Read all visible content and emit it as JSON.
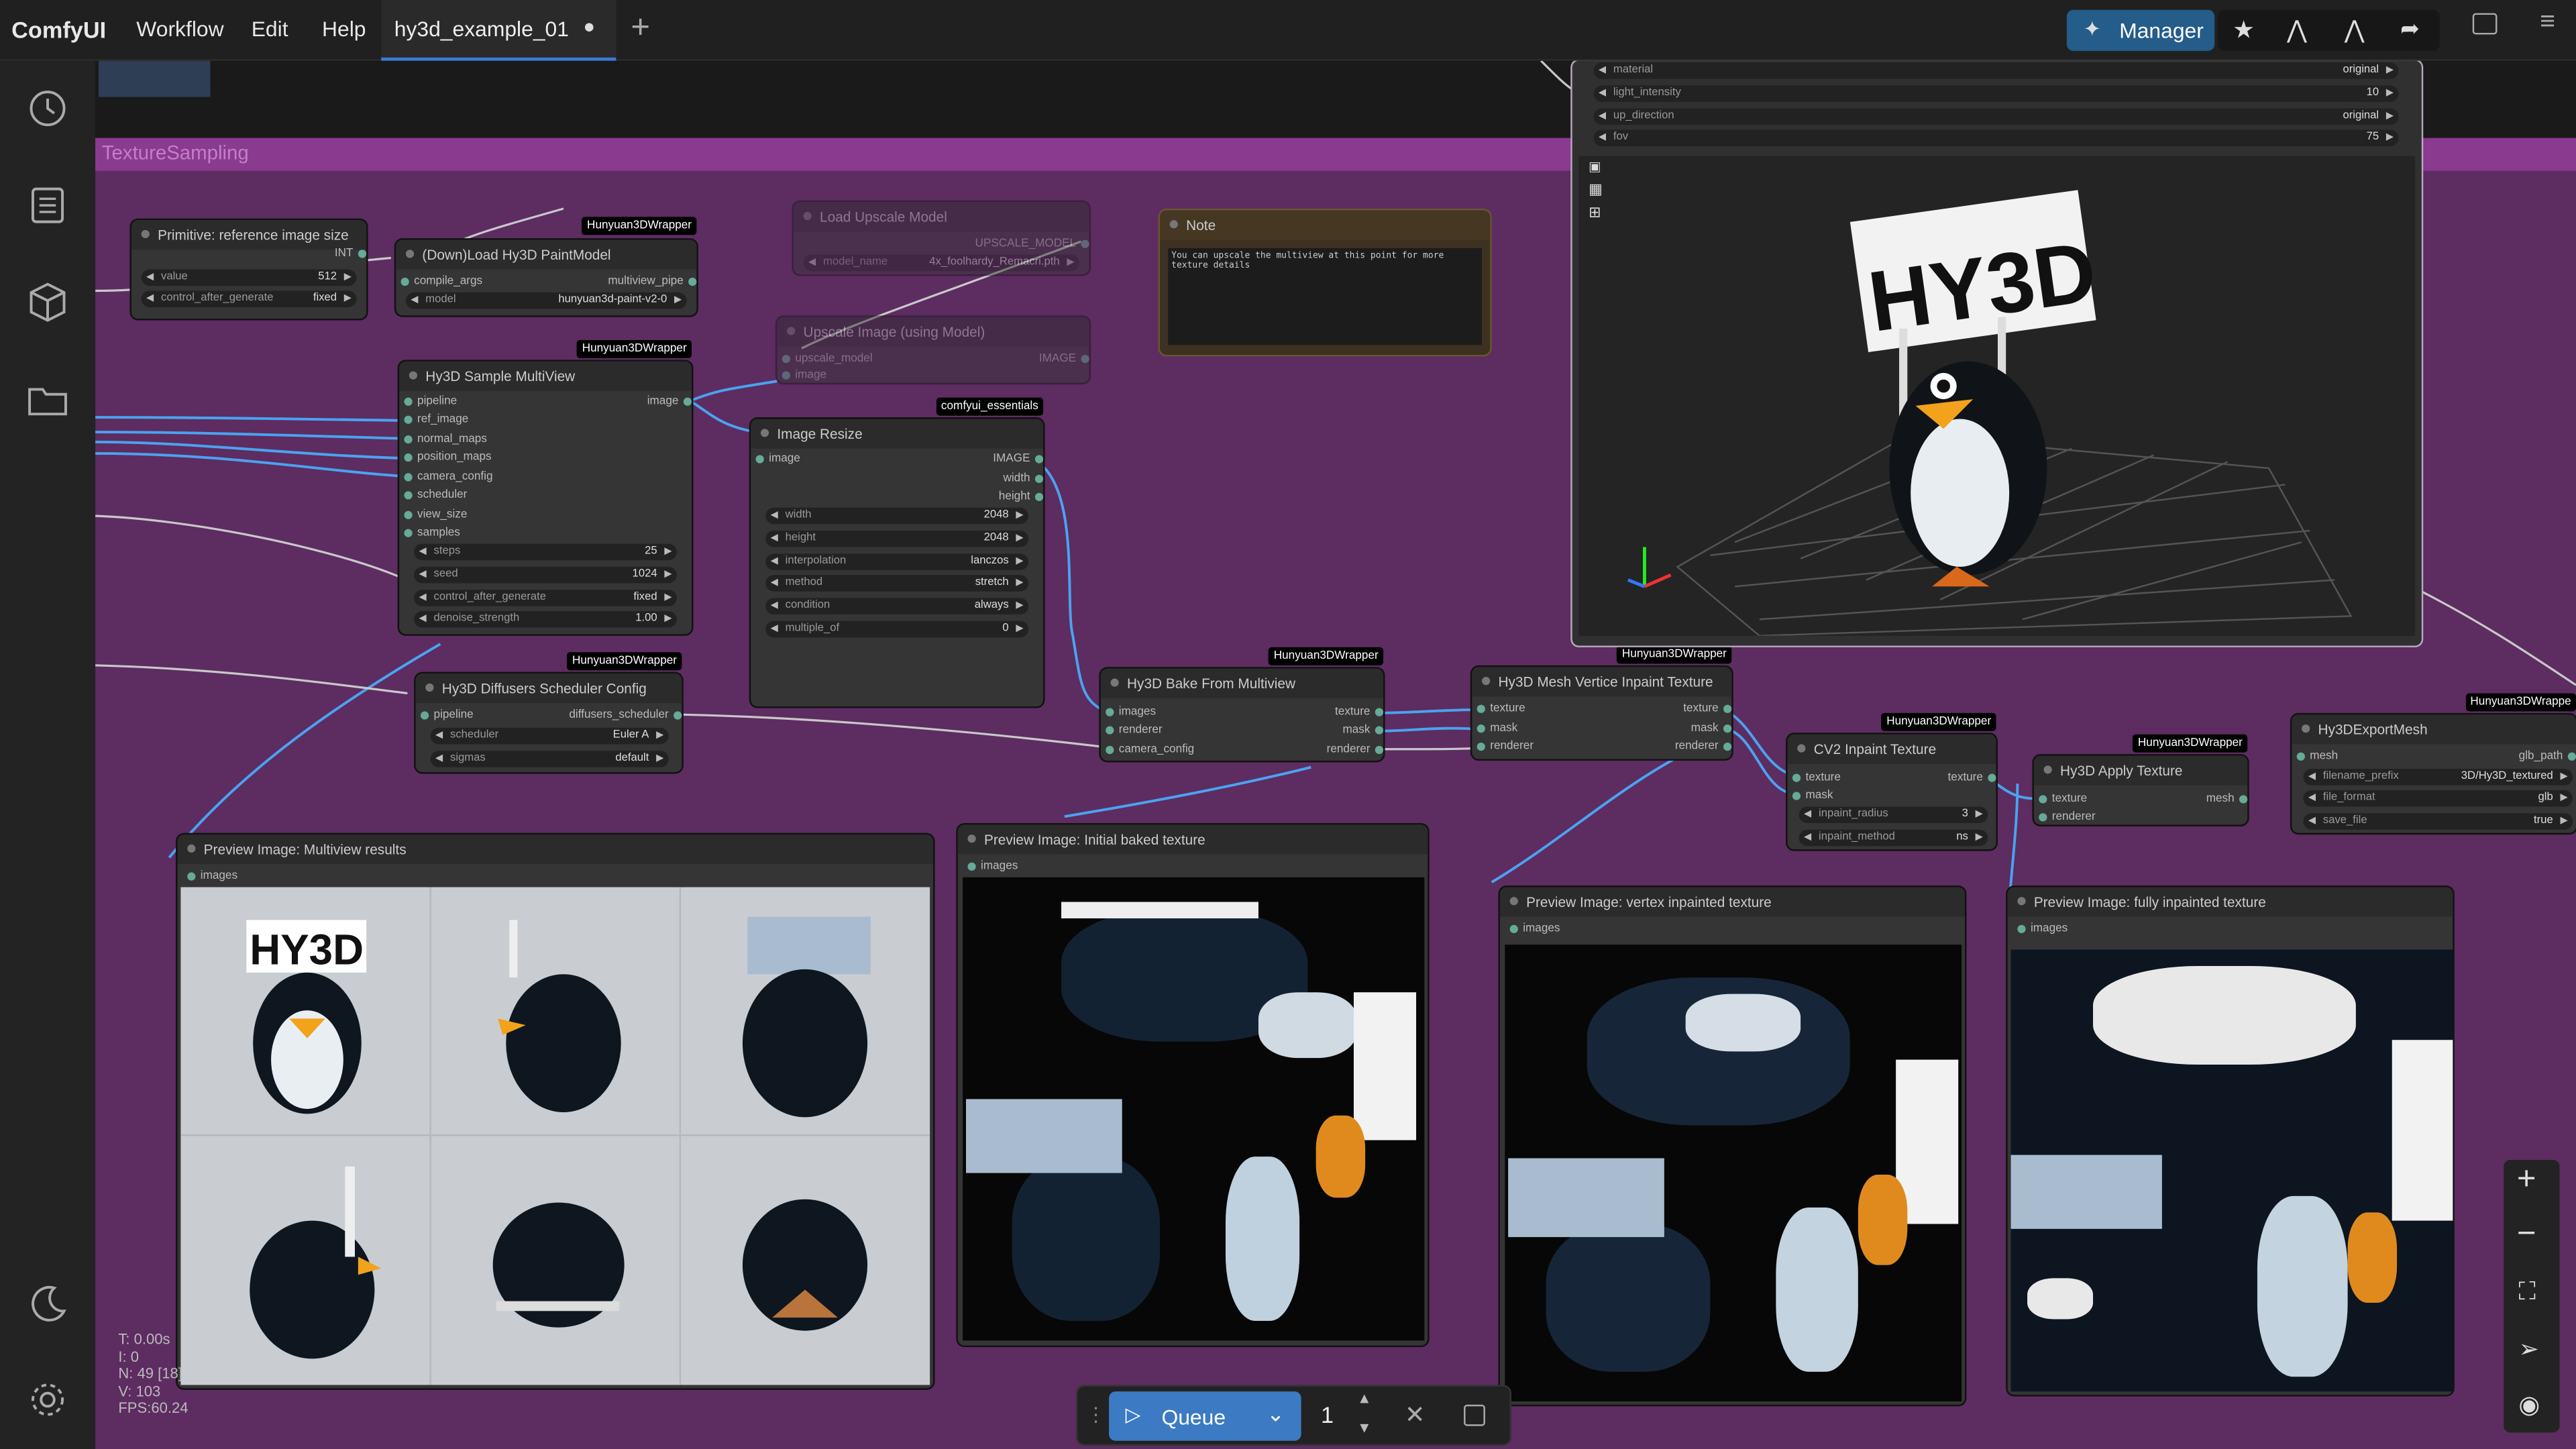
{
  "app": {
    "name": "ComfyUI",
    "menus": [
      "Workflow",
      "Edit",
      "Help"
    ],
    "tab": "hy3d_example_01",
    "manager_label": "Manager"
  },
  "group": {
    "title": "TextureSampling"
  },
  "nodes": {
    "primitive": {
      "title": "Primitive: reference image size",
      "out": "INT",
      "w": [
        [
          "value",
          "512"
        ],
        [
          "control_after_generate",
          "fixed"
        ]
      ]
    },
    "paintmodel": {
      "title": "(Down)Load Hy3D PaintModel",
      "badge": "Hunyuan3DWrapper",
      "in": "compile_args",
      "out": "multiview_pipe",
      "w": [
        [
          "model",
          "hunyuan3d-paint-v2-0"
        ]
      ]
    },
    "upscalemodel": {
      "title": "Load Upscale Model",
      "out": "UPSCALE_MODEL",
      "w": [
        [
          "model_name",
          "4x_foolhardy_Remacri.pth"
        ]
      ]
    },
    "upscaleimage": {
      "title": "Upscale Image (using Model)",
      "in1": "upscale_model",
      "in2": "image",
      "out": "IMAGE"
    },
    "note": {
      "title": "Note",
      "text": "You can upscale the multiview at this point for more texture details"
    },
    "multiview": {
      "title": "Hy3D Sample MultiView",
      "badge": "Hunyuan3DWrapper",
      "ins": [
        "pipeline",
        "ref_image",
        "normal_maps",
        "position_maps",
        "camera_config",
        "scheduler",
        "view_size",
        "samples"
      ],
      "out": "image",
      "w": [
        [
          "steps",
          "25"
        ],
        [
          "seed",
          "1024"
        ],
        [
          "control_after_generate",
          "fixed"
        ],
        [
          "denoise_strength",
          "1.00"
        ]
      ]
    },
    "resize": {
      "title": "Image Resize",
      "badge": "comfyui_essentials",
      "in": "image",
      "outs": [
        "IMAGE",
        "width",
        "height"
      ],
      "w": [
        [
          "width",
          "2048"
        ],
        [
          "height",
          "2048"
        ],
        [
          "interpolation",
          "lanczos"
        ],
        [
          "method",
          "stretch"
        ],
        [
          "condition",
          "always"
        ],
        [
          "multiple_of",
          "0"
        ]
      ]
    },
    "scheduler": {
      "title": "Hy3D Diffusers Scheduler Config",
      "badge": "Hunyuan3DWrapper",
      "in": "pipeline",
      "out": "diffusers_scheduler",
      "w": [
        [
          "scheduler",
          "Euler A"
        ],
        [
          "sigmas",
          "default"
        ]
      ]
    },
    "bake": {
      "title": "Hy3D Bake From Multiview",
      "badge": "Hunyuan3DWrapper",
      "ins": [
        "images",
        "renderer",
        "camera_config"
      ],
      "outs": [
        "texture",
        "mask",
        "renderer"
      ]
    },
    "vinpaint": {
      "title": "Hy3D Mesh Vertice Inpaint Texture",
      "badge": "Hunyuan3DWrapper",
      "ins": [
        "texture",
        "mask",
        "renderer"
      ],
      "outs": [
        "texture",
        "mask",
        "renderer"
      ]
    },
    "cv2": {
      "title": "CV2 Inpaint Texture",
      "badge": "Hunyuan3DWrapper",
      "ins": [
        "texture",
        "mask"
      ],
      "out": "texture",
      "w": [
        [
          "inpaint_radius",
          "3"
        ],
        [
          "inpaint_method",
          "ns"
        ]
      ]
    },
    "apply": {
      "title": "Hy3D Apply Texture",
      "badge": "Hunyuan3DWrapper",
      "ins": [
        "texture",
        "renderer"
      ],
      "out": "mesh"
    },
    "export": {
      "title": "Hy3DExportMesh",
      "badge": "Hunyuan3DWrappe",
      "in": "mesh",
      "out": "glb_path",
      "w": [
        [
          "filename_prefix",
          "3D/Hy3D_textured"
        ],
        [
          "file_format",
          "glb"
        ],
        [
          "save_file",
          "true"
        ]
      ]
    },
    "viewer": {
      "w": [
        [
          "material",
          "original"
        ],
        [
          "light_intensity",
          "10"
        ],
        [
          "up_direction",
          "original"
        ],
        [
          "fov",
          "75"
        ]
      ]
    },
    "prev1": {
      "title": "Preview Image: Multiview results",
      "in": "images"
    },
    "prev2": {
      "title": "Preview Image: Initial baked texture",
      "in": "images"
    },
    "prev3": {
      "title": "Preview Image: vertex inpainted texture",
      "in": "images"
    },
    "prev4": {
      "title": "Preview Image: fully inpainted texture",
      "in": "images"
    }
  },
  "sign_text": "HY3D",
  "stats": {
    "t": "T: 0.00s",
    "i": "I: 0",
    "n": "N: 49 [18]",
    "v": "V: 103",
    "fps": "FPS:60.24"
  },
  "queue": {
    "label": "Queue",
    "count": "1"
  },
  "colors": {
    "accent": "#3a7bd5",
    "group": "#5d2c61",
    "group_header": "#8a3a8f",
    "link": "#4aa3f0"
  },
  "icons": [
    "history-icon",
    "node-library-icon",
    "model-library-icon",
    "workflows-icon",
    "theme-icon",
    "settings-icon"
  ]
}
